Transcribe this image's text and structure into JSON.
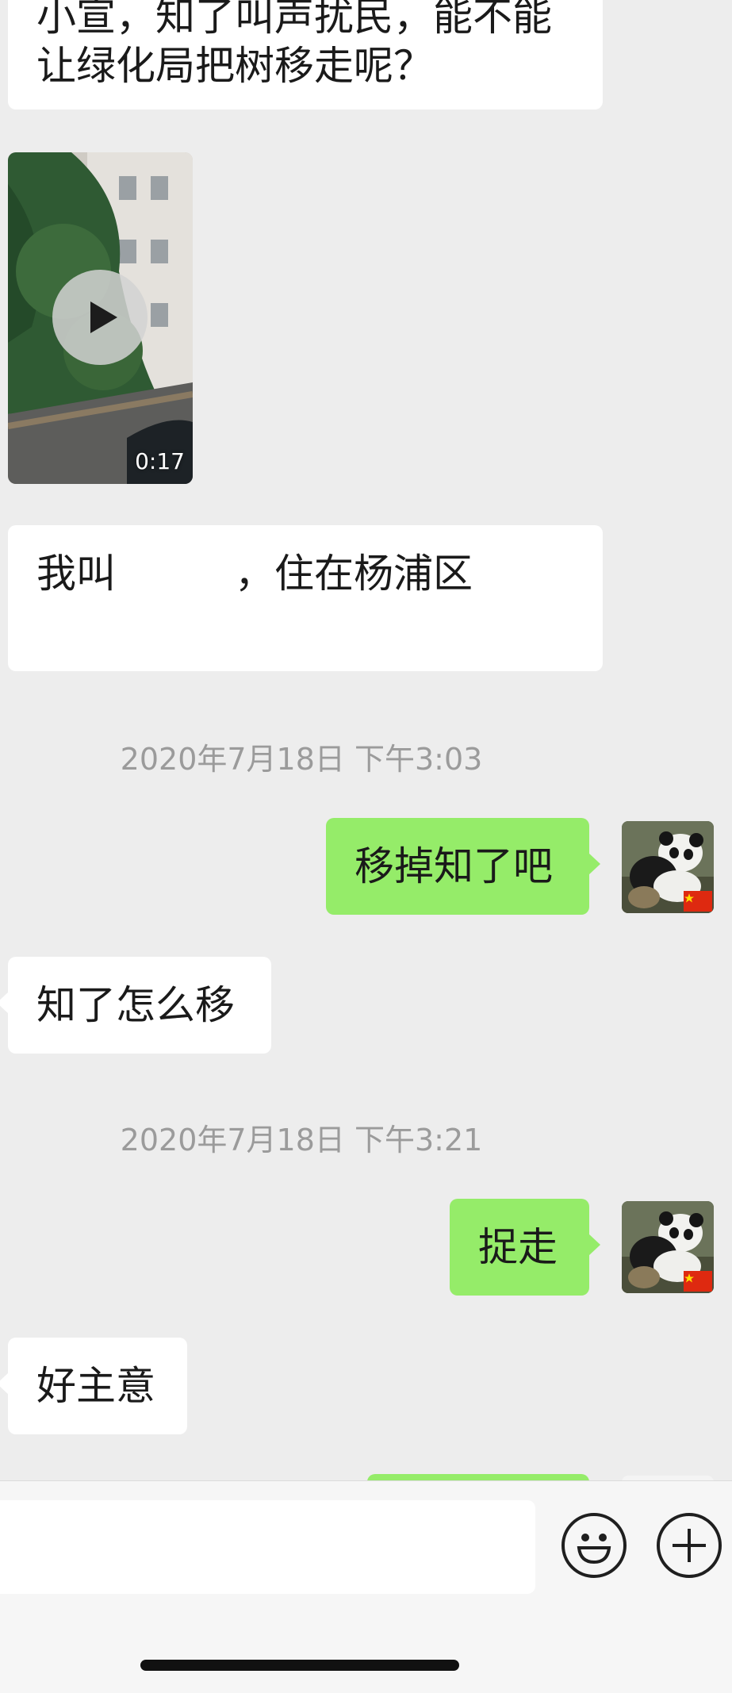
{
  "colors": {
    "background": "#ededed",
    "incoming_bubble": "#ffffff",
    "outgoing_bubble": "#95ec69",
    "timestamp_text": "#9b9b9b"
  },
  "messages": {
    "m1_line1": "小宣，知了叫声扰民，能不能",
    "m1_line2": "让绿化局把树移走呢？",
    "video": {
      "duration": "0:17",
      "icon": "play-icon"
    },
    "m2_name_prefix": "我叫",
    "m2_rest": "，住在杨浦区",
    "ts1": "2020年7月18日 下午3:03",
    "m3": "移掉知了吧",
    "m4": "知了怎么移",
    "ts2": "2020年7月18日 下午3:21",
    "m5": "捉走",
    "m6": "好主意"
  },
  "avatar": {
    "icon": "panda-avatar",
    "badge": "china-flag-icon"
  },
  "composer": {
    "emoji_icon": "smiley-icon",
    "plus_icon": "plus-circle-icon"
  }
}
